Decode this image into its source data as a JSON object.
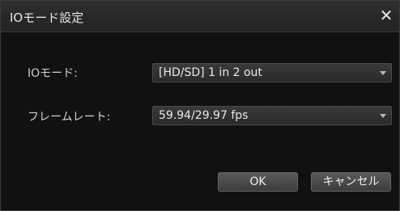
{
  "dialog": {
    "title": "IOモード設定",
    "close_glyph": "✕"
  },
  "io_mode": {
    "label": "IOモード:",
    "selected": "[HD/SD] 1 in 2 out"
  },
  "frame_rate": {
    "label": "フレームレート:",
    "selected": "59.94/29.97 fps"
  },
  "buttons": {
    "ok": "OK",
    "cancel": "キャンセル"
  },
  "icons": {
    "close": "close-icon",
    "dropdown": "chevron-down-icon"
  }
}
